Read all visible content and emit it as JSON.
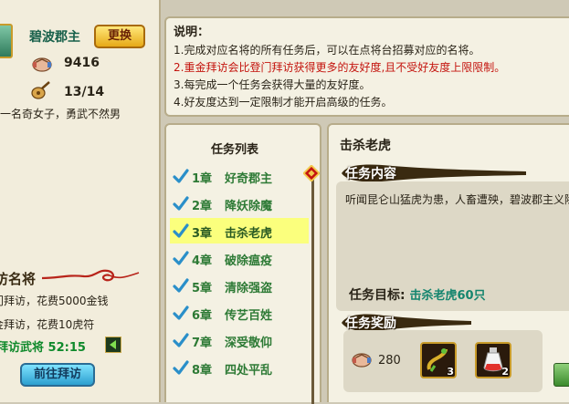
{
  "character": {
    "name": "碧波郡主",
    "swap_label": "更换",
    "friendship": "9416",
    "tasks_progress": "13/14",
    "bio": "一名奇女子，勇武不然男"
  },
  "visit": {
    "section_title": "访名将",
    "option_1": "门拜访，花费5000金钱",
    "option_2": "金拜访，花费10虎符",
    "count_label": "拜访武将",
    "count_value": "52:15",
    "go_label": "前往拜访"
  },
  "notes": {
    "title": "说明：",
    "lines": [
      "1.完成对应名将的所有任务后，可以在点将台招募对应的名将。",
      "2.重金拜访会比登门拜访获得更多的友好度,且不受好友度上限限制。",
      "3.每完成一个任务会获得大量的友好度。",
      "4.好友度达到一定限制才能开启高级的任务。"
    ]
  },
  "task_list": {
    "title": "任务列表",
    "items": [
      {
        "chapter": "1章",
        "name": "好奇郡主"
      },
      {
        "chapter": "2章",
        "name": "降妖除魔"
      },
      {
        "chapter": "3章",
        "name": "击杀老虎"
      },
      {
        "chapter": "4章",
        "name": "破除瘟疫"
      },
      {
        "chapter": "5章",
        "name": "清除强盗"
      },
      {
        "chapter": "6章",
        "name": "传艺百姓"
      },
      {
        "chapter": "7章",
        "name": "深受敬仰"
      },
      {
        "chapter": "8章",
        "name": "四处平乱"
      }
    ],
    "selected_index": 2
  },
  "detail": {
    "title": "击杀老虎",
    "content_banner": "任务内容",
    "content": "听闻昆仑山猛虎为患，人畜遭殃，碧波郡主义除害",
    "goal_label": "任务目标:",
    "goal_value": "击杀老虎60只",
    "reward_banner": "任务奖励",
    "reward_friendship": "280",
    "reward_items": [
      {
        "icon": "gourd-item-icon",
        "count": "3"
      },
      {
        "icon": "potion-item-icon",
        "count": "2"
      }
    ]
  },
  "colors": {
    "accent_green": "#2d7a35",
    "warning_red": "#c4140e",
    "highlight_yellow": "#fbff7d"
  }
}
